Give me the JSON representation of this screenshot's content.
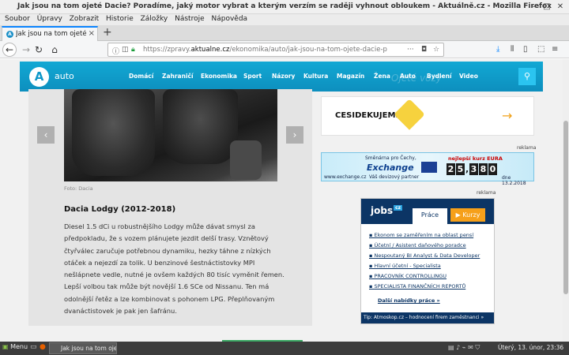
{
  "window": {
    "title": "Jak jsou na tom ojeté Dacie? Poradíme, jaký motor vybrat a kterým verzím se raději vyhnout obloukem - Aktuálně.cz - Mozilla Firefox"
  },
  "menubar": [
    "Soubor",
    "Úpravy",
    "Zobrazit",
    "Historie",
    "Záložky",
    "Nástroje",
    "Nápověda"
  ],
  "tab": {
    "label": "Jak jsou na tom ojeté Da"
  },
  "urlbar": {
    "prefix": "https://zpravy.",
    "domain": "aktualne.cz",
    "path": "/ekonomika/auto/jak-jsou-na-tom-ojete-dacie-p",
    "more": "···"
  },
  "site": {
    "logo": "A",
    "section": "auto",
    "watermark": "Ojeté vozy",
    "nav": [
      "Domácí",
      "Zahraničí",
      "Ekonomika",
      "Sport",
      "Názory",
      "Kultura",
      "Magazín",
      "Žena",
      "Auto",
      "Bydlení",
      "Video"
    ]
  },
  "article": {
    "photo_credit": "Foto: Dacia",
    "heading": "Dacia Lodgy (2012-2018)",
    "text": "Diesel 1.5 dCi u robustnějšího Lodgy může dávat smysl za předpokladu, že s vozem plánujete jezdit delší trasy. Vznětový čtyřválec zaručuje potřebnou dynamiku, hezky táhne z nízkých otáček a nejezdí za tolik. U benzinové šestnáctistovky MPI nešlápnete vedle, nutné je ovšem každých 80 tisíc vyměnit řemen. Lepší volbou tak může být novější 1.6 SCe od Nissanu. Ten má odolnější řetěz a lze kombinovat s pohonem LPG. Přeplňovaným dvanáctistovek je pak jen šafránu."
  },
  "ads": {
    "label": "reklama",
    "banner1_text": "CESIDEKUJEM.CZ",
    "exchange": {
      "top": "Směnárna pro Čechy,",
      "brand": "Exchange",
      "sub": "Váš devizový partner",
      "site": "www.exchange.cz",
      "rate_label": "nejlepší kurz EURA",
      "digits": [
        "2",
        "5",
        ",",
        "3",
        "8",
        "0"
      ],
      "date": "dne 13.2.2018"
    }
  },
  "jobs": {
    "logo": "jobs",
    "logo_suffix": "cz",
    "tab_prace": "Práce",
    "tab_kurzy": "Kurzy",
    "items": [
      "Ekonom se zaměřením na oblast pensí",
      "Účetní / Asistent daňového poradce",
      "Nespoutaný BI Analyst & Data Developer",
      "Hlavní účetní - Specialista",
      "PRACOVNÍK CONTROLLINGU",
      "SPECIALISTA FINANČNÍCH REPORTŮ"
    ],
    "more": "Další nabídky práce »",
    "footer": "Tip: Atmoskop.cz – hodnocení firem zaměstnanci »"
  },
  "taskbar": {
    "menu": "Menu",
    "window": "Jak jsou na tom ojeté",
    "clock": "Úterý, 13. únor, 23:36"
  }
}
